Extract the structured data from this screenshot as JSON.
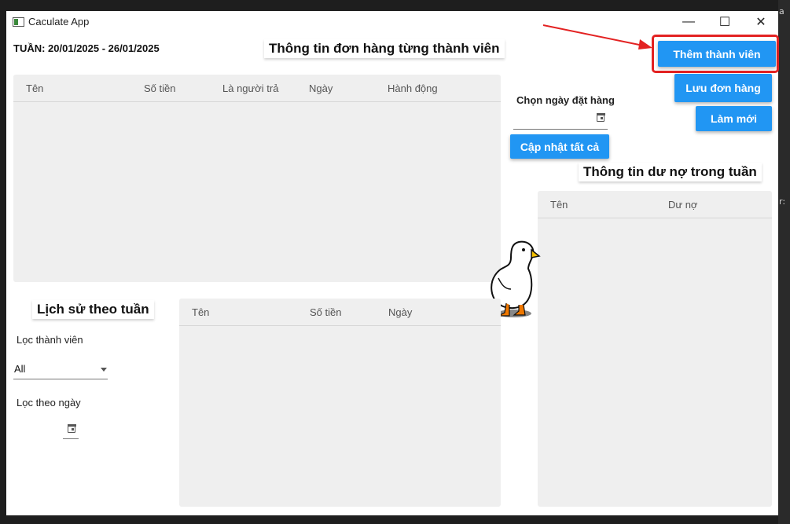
{
  "window": {
    "title": "Caculate App"
  },
  "titlebar_buttons": {
    "minimize": "—",
    "maximize": "☐",
    "close": "✕"
  },
  "header": {
    "week_label": "TUẦN: 20/01/2025 - 26/01/2025",
    "orders_title": "Thông tin đơn hàng từng thành viên"
  },
  "orders_table": {
    "columns": [
      "Tên",
      "Số tiền",
      "Là người trả",
      "Ngày",
      "Hành động"
    ]
  },
  "actions": {
    "add_member": "Thêm thành viên",
    "save_order": "Lưu đơn hàng",
    "refresh": "Làm mới",
    "update_all": "Cập nhật tất cả",
    "order_date_label": "Chọn ngày đặt hàng"
  },
  "debt": {
    "title": "Thông tin dư nợ trong tuần",
    "columns": [
      "Tên",
      "Dư nợ"
    ]
  },
  "history": {
    "title": "Lịch sử theo tuần",
    "filter_member_label": "Lọc thành viên",
    "filter_member_value": "All",
    "filter_date_label": "Lọc theo ngày",
    "columns": [
      "Tên",
      "Số tiền",
      "Ngày"
    ]
  },
  "colors": {
    "accent": "#2196f3",
    "annotation": "#e32222",
    "panel": "#efefef"
  },
  "backdrop_text": [
    "a",
    "r:"
  ]
}
